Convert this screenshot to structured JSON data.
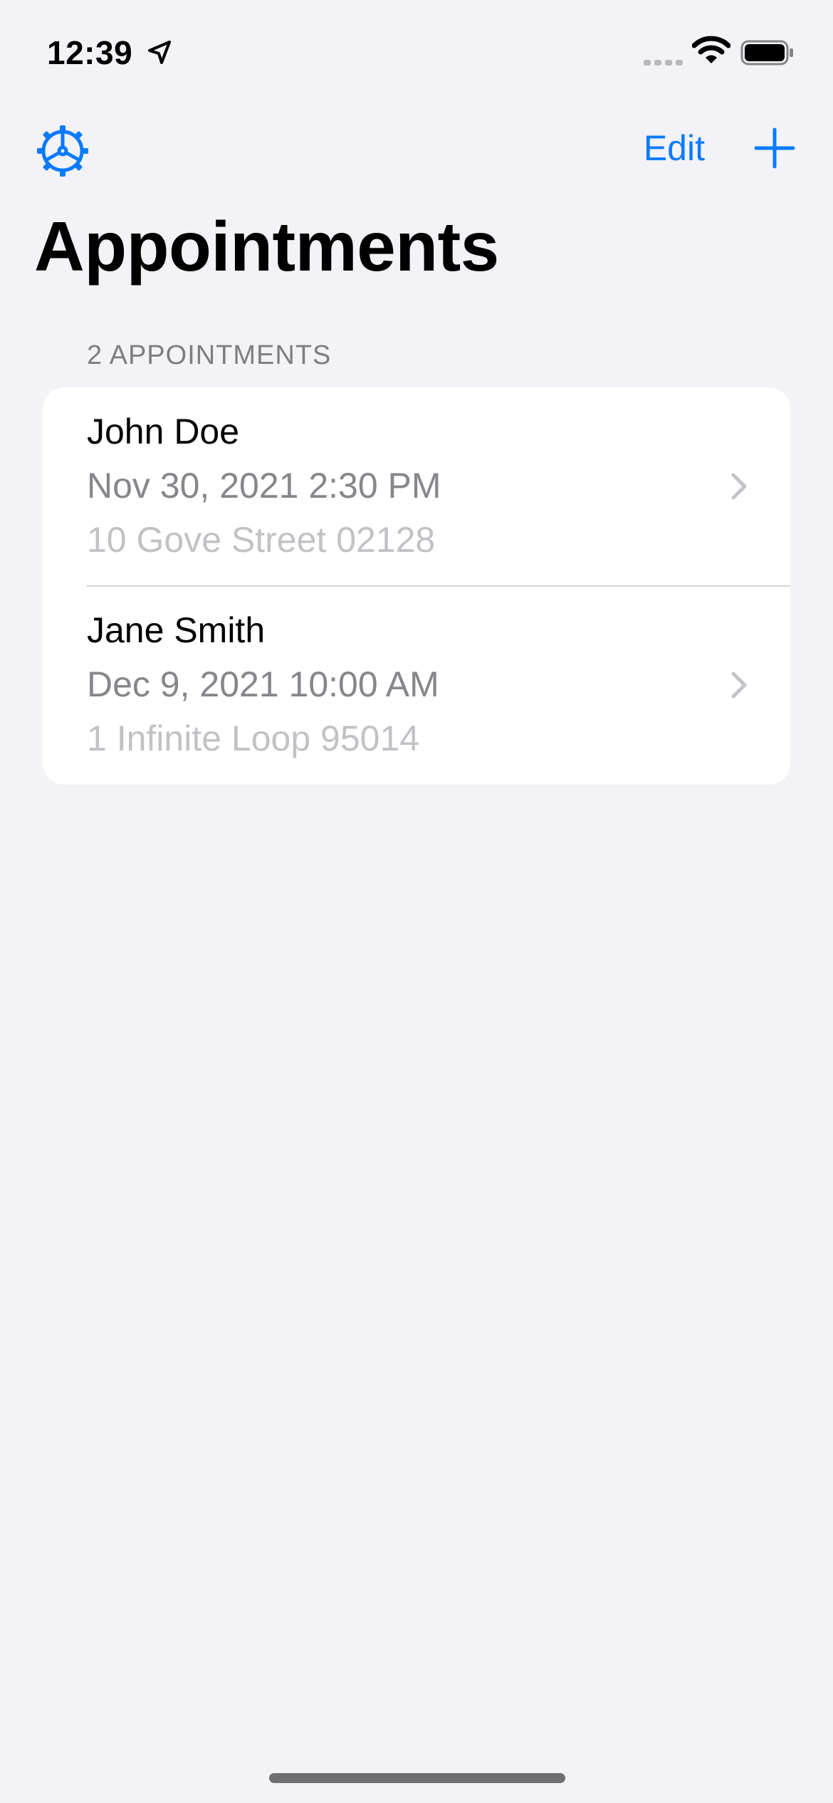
{
  "status_bar": {
    "time": "12:39",
    "icons": [
      "location-arrow-icon",
      "cellular-signal-icon",
      "wifi-icon",
      "battery-icon"
    ]
  },
  "nav": {
    "edit_label": "Edit",
    "settings_icon": "gear-icon",
    "add_icon": "plus-icon"
  },
  "title": "Appointments",
  "section": {
    "header": "2 APPOINTMENTS"
  },
  "appointments": [
    {
      "name": "John Doe",
      "datetime": "Nov 30, 2021 2:30 PM",
      "address": "10 Gove Street 02128"
    },
    {
      "name": "Jane Smith",
      "datetime": "Dec 9, 2021 10:00 AM",
      "address": "1 Infinite Loop 95014"
    }
  ],
  "colors": {
    "accent": "#0a7aff",
    "background": "#f2f2f7",
    "card": "#ffffff",
    "secondary_text": "#86868b",
    "tertiary_text": "#c2c2c6"
  }
}
